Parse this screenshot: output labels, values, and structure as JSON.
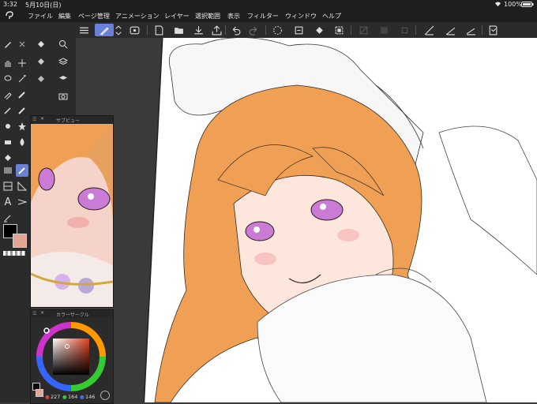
{
  "status": {
    "time": "3:32",
    "date": "5月10日(日)",
    "battery": "100%"
  },
  "menu": [
    "ファイル",
    "編集",
    "ページ管理",
    "アニメーション",
    "レイヤー",
    "選択範囲",
    "表示",
    "フィルター",
    "ウィンドウ",
    "ヘルプ"
  ],
  "panels": {
    "subview": {
      "title": "サブビュー"
    },
    "colorcircle": {
      "title": "カラーサークル",
      "r": "227",
      "g": "164",
      "b": "146"
    }
  },
  "colors": {
    "main": "#000000",
    "sub": "#e3a492",
    "hair": "#f0a055",
    "accent": "#6a7fd6"
  },
  "icons": {
    "app": "clip-studio-logo-icon",
    "wifi": "wifi-icon",
    "battery": "battery-icon"
  }
}
